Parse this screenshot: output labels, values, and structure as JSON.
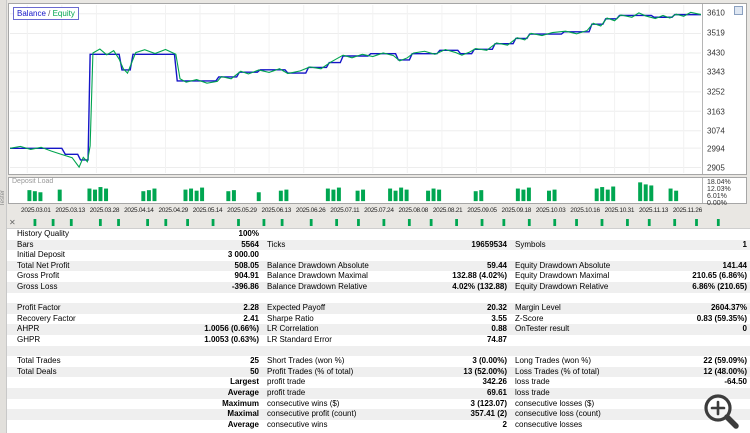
{
  "app": {
    "side_tab_label": "Tester"
  },
  "chart": {
    "legend": {
      "balance": "Balance",
      "separator": " / ",
      "equity": "Equity"
    },
    "y_axis_labels": [
      "3610",
      "3519",
      "3430",
      "3343",
      "3252",
      "3163",
      "3074",
      "2994",
      "2905"
    ],
    "colors": {
      "balance": "#1515c8",
      "equity": "#00a44e",
      "grid": "#ededed",
      "bar": "#00a651"
    }
  },
  "chart_data": [
    {
      "type": "line",
      "title": "Balance / Equity",
      "ylim": [
        2880,
        3650
      ],
      "y_ticks": [
        3610,
        3519,
        3430,
        3343,
        3252,
        3163,
        3074,
        2994,
        2905
      ],
      "legend_position": "top-left",
      "series": [
        {
          "name": "Balance",
          "color": "#1515c8",
          "points": [
            [
              0,
              2993
            ],
            [
              7.5,
              2993
            ],
            [
              8,
              2966
            ],
            [
              9.8,
              2966
            ],
            [
              10.2,
              2940
            ],
            [
              11.3,
              2940
            ],
            [
              11.6,
              3424
            ],
            [
              15.8,
              3424
            ],
            [
              16.2,
              3352
            ],
            [
              17.4,
              3352
            ],
            [
              17.8,
              3424
            ],
            [
              23.8,
              3424
            ],
            [
              24.2,
              3302
            ],
            [
              29.8,
              3302
            ],
            [
              30.2,
              3320
            ],
            [
              32.8,
              3320
            ],
            [
              33.2,
              3342
            ],
            [
              35.8,
              3342
            ],
            [
              36.2,
              3353
            ],
            [
              39.8,
              3353
            ],
            [
              40.2,
              3338
            ],
            [
              42.8,
              3338
            ],
            [
              43.2,
              3364
            ],
            [
              45.8,
              3364
            ],
            [
              46.2,
              3386
            ],
            [
              47.8,
              3386
            ],
            [
              48.2,
              3416
            ],
            [
              51.8,
              3416
            ],
            [
              52.2,
              3427
            ],
            [
              55.8,
              3427
            ],
            [
              56.2,
              3398
            ],
            [
              57.8,
              3398
            ],
            [
              58.2,
              3427
            ],
            [
              61.8,
              3427
            ],
            [
              62.2,
              3442
            ],
            [
              64.8,
              3442
            ],
            [
              65.2,
              3427
            ],
            [
              66.8,
              3427
            ],
            [
              67.2,
              3447
            ],
            [
              69.8,
              3447
            ],
            [
              70.2,
              3473
            ],
            [
              72.8,
              3473
            ],
            [
              73.2,
              3497
            ],
            [
              74.8,
              3497
            ],
            [
              75.2,
              3517
            ],
            [
              79.8,
              3517
            ],
            [
              80.2,
              3527
            ],
            [
              83.8,
              3527
            ],
            [
              84.2,
              3562
            ],
            [
              85.8,
              3562
            ],
            [
              86.2,
              3587
            ],
            [
              87.8,
              3587
            ],
            [
              88.2,
              3602
            ],
            [
              92.8,
              3602
            ],
            [
              93.2,
              3594
            ],
            [
              95.8,
              3594
            ],
            [
              96.2,
              3606
            ],
            [
              100,
              3606
            ]
          ]
        },
        {
          "name": "Equity",
          "color": "#00a44e",
          "points": [
            [
              0,
              2993
            ],
            [
              1.5,
              3002
            ],
            [
              3,
              2988
            ],
            [
              4.5,
              2998
            ],
            [
              6,
              2980
            ],
            [
              7.5,
              2965
            ],
            [
              9,
              2950
            ],
            [
              10,
              2907
            ],
            [
              10.6,
              2952
            ],
            [
              11.2,
              2932
            ],
            [
              11.6,
              3005
            ],
            [
              12,
              3430
            ],
            [
              13,
              3448
            ],
            [
              14,
              3422
            ],
            [
              15,
              3441
            ],
            [
              15.8,
              3402
            ],
            [
              16.4,
              3358
            ],
            [
              17,
              3338
            ],
            [
              17.6,
              3385
            ],
            [
              18.2,
              3432
            ],
            [
              19.5,
              3445
            ],
            [
              21,
              3428
            ],
            [
              22.5,
              3446
            ],
            [
              24,
              3424
            ],
            [
              24.6,
              3312
            ],
            [
              25.5,
              3296
            ],
            [
              27,
              3308
            ],
            [
              28.5,
              3292
            ],
            [
              30,
              3300
            ],
            [
              30.6,
              3322
            ],
            [
              32,
              3312
            ],
            [
              33.4,
              3346
            ],
            [
              34.5,
              3334
            ],
            [
              36,
              3352
            ],
            [
              37.5,
              3341
            ],
            [
              39,
              3358
            ],
            [
              40.2,
              3336
            ],
            [
              42,
              3348
            ],
            [
              43.4,
              3366
            ],
            [
              45,
              3358
            ],
            [
              46.4,
              3388
            ],
            [
              48.2,
              3420
            ],
            [
              49.5,
              3408
            ],
            [
              51,
              3424
            ],
            [
              52.5,
              3414
            ],
            [
              54,
              3430
            ],
            [
              55.5,
              3418
            ],
            [
              56.4,
              3394
            ],
            [
              57.5,
              3408
            ],
            [
              58.4,
              3430
            ],
            [
              60,
              3438
            ],
            [
              61.5,
              3424
            ],
            [
              63,
              3446
            ],
            [
              64.5,
              3432
            ],
            [
              65.4,
              3420
            ],
            [
              66.5,
              3434
            ],
            [
              67.4,
              3450
            ],
            [
              69,
              3442
            ],
            [
              70.4,
              3476
            ],
            [
              72,
              3466
            ],
            [
              73.4,
              3500
            ],
            [
              74.5,
              3490
            ],
            [
              75.4,
              3520
            ],
            [
              77,
              3510
            ],
            [
              78.5,
              3524
            ],
            [
              80.4,
              3530
            ],
            [
              82,
              3518
            ],
            [
              83.5,
              3532
            ],
            [
              84.4,
              3566
            ],
            [
              85.5,
              3554
            ],
            [
              86.4,
              3590
            ],
            [
              87.5,
              3578
            ],
            [
              88.4,
              3604
            ],
            [
              90,
              3594
            ],
            [
              91,
              3614
            ],
            [
              92,
              3600
            ],
            [
              93.4,
              3588
            ],
            [
              94.5,
              3602
            ],
            [
              95.5,
              3590
            ],
            [
              96.4,
              3608
            ],
            [
              97.5,
              3598
            ],
            [
              98.5,
              3616
            ],
            [
              100,
              3606
            ]
          ]
        }
      ]
    },
    {
      "type": "bar",
      "title": "Deposit Load",
      "ylim": [
        0,
        19.5
      ],
      "scale_labels": [
        "18.04%",
        "12.03%",
        "6.01%",
        "0.00%"
      ],
      "bars": [
        [
          2.8,
          10.5
        ],
        [
          3.6,
          9.5
        ],
        [
          4.4,
          8.5
        ],
        [
          7.2,
          11
        ],
        [
          11.5,
          12
        ],
        [
          12.3,
          11
        ],
        [
          13.1,
          13.5
        ],
        [
          13.9,
          12
        ],
        [
          19.3,
          9.5
        ],
        [
          20.1,
          10.5
        ],
        [
          20.9,
          12
        ],
        [
          25.4,
          11
        ],
        [
          26.2,
          12
        ],
        [
          27.0,
          10
        ],
        [
          27.8,
          13
        ],
        [
          31.6,
          9.5
        ],
        [
          32.4,
          10.5
        ],
        [
          36.0,
          8.5
        ],
        [
          39.2,
          10
        ],
        [
          40.0,
          11
        ],
        [
          46.0,
          12
        ],
        [
          46.8,
          11
        ],
        [
          47.6,
          13
        ],
        [
          50.3,
          10
        ],
        [
          51.1,
          11
        ],
        [
          55.0,
          12
        ],
        [
          55.8,
          10
        ],
        [
          56.6,
          13
        ],
        [
          57.4,
          11
        ],
        [
          60.5,
          10
        ],
        [
          61.3,
          12
        ],
        [
          62.1,
          11
        ],
        [
          67.4,
          9.5
        ],
        [
          68.2,
          10.5
        ],
        [
          73.5,
          12
        ],
        [
          74.3,
          11
        ],
        [
          75.1,
          13
        ],
        [
          78.0,
          10
        ],
        [
          78.8,
          11
        ],
        [
          84.9,
          12
        ],
        [
          85.7,
          13.5
        ],
        [
          86.5,
          11
        ],
        [
          87.3,
          14
        ],
        [
          91.2,
          18
        ],
        [
          92.0,
          16
        ],
        [
          92.8,
          15
        ],
        [
          95.6,
          12
        ],
        [
          96.4,
          10
        ]
      ]
    }
  ],
  "deposit": {
    "label": "Deposit Load"
  },
  "date_axis": {
    "labels": [
      "2025.03.01",
      "2025.03.13",
      "2025.03.28",
      "2025.04.14",
      "2025.04.29",
      "2025.05.14",
      "2025.05.29",
      "2025.06.13",
      "2025.06.26",
      "2025.07.11",
      "2025.07.24",
      "2025.08.08",
      "2025.08.21",
      "2025.09.05",
      "2025.09.18",
      "2025.10.03",
      "2025.10.16",
      "2025.10.31",
      "2025.11.13",
      "2025.11.26"
    ]
  },
  "tick_strip": {
    "close_label": "✕",
    "positions": [
      2,
      4.5,
      7,
      11,
      13.5,
      17.5,
      20,
      23,
      26.5,
      30,
      33.5,
      36,
      40,
      43.5,
      46.5,
      50,
      53.5,
      56.5,
      60,
      63.5,
      66.5,
      70,
      73.5,
      76.5,
      80,
      83.5,
      86.5,
      90,
      93,
      96
    ]
  },
  "table": {
    "rows": [
      {
        "cells": [
          "History Quality",
          "100%",
          "",
          "",
          "",
          ""
        ]
      },
      {
        "cells": [
          "Bars",
          "5564",
          "Ticks",
          "19659534",
          "Symbols",
          "1"
        ]
      },
      {
        "cells": [
          "Initial Deposit",
          "3 000.00",
          "",
          "",
          "",
          ""
        ]
      },
      {
        "cells": [
          "Total Net Profit",
          "508.05",
          "Balance Drawdown Absolute",
          "59.44",
          "Equity Drawdown Absolute",
          "141.44"
        ]
      },
      {
        "cells": [
          "Gross Profit",
          "904.91",
          "Balance Drawdown Maximal",
          "132.88 (4.02%)",
          "Equity Drawdown Maximal",
          "210.65 (6.86%)"
        ]
      },
      {
        "cells": [
          "Gross Loss",
          "-396.86",
          "Balance Drawdown Relative",
          "4.02% (132.88)",
          "Equity Drawdown Relative",
          "6.86% (210.65)"
        ]
      },
      {
        "cells": [
          "",
          "",
          "",
          "",
          "",
          ""
        ]
      },
      {
        "cells": [
          "Profit Factor",
          "2.28",
          "Expected Payoff",
          "20.32",
          "Margin Level",
          "2604.37%"
        ]
      },
      {
        "cells": [
          "Recovery Factor",
          "2.41",
          "Sharpe Ratio",
          "3.55",
          "Z-Score",
          "0.83 (59.35%)"
        ]
      },
      {
        "cells": [
          "AHPR",
          "1.0056 (0.66%)",
          "LR Correlation",
          "0.88",
          "OnTester result",
          "0"
        ]
      },
      {
        "cells": [
          "GHPR",
          "1.0053 (0.63%)",
          "LR Standard Error",
          "74.87",
          "",
          ""
        ]
      },
      {
        "cells": [
          "",
          "",
          "",
          "",
          "",
          ""
        ]
      },
      {
        "cells": [
          "Total Trades",
          "25",
          "Short Trades (won %)",
          "3 (0.00%)",
          "Long Trades (won %)",
          "22 (59.09%)"
        ]
      },
      {
        "cells": [
          "Total Deals",
          "50",
          "Profit Trades (% of total)",
          "13 (52.00%)",
          "Loss Trades (% of total)",
          "12 (48.00%)"
        ]
      },
      {
        "cells": [
          "",
          "Largest",
          "profit trade",
          "342.26",
          "loss trade",
          "-64.50"
        ]
      },
      {
        "cells": [
          "",
          "Average",
          "profit trade",
          "69.61",
          "loss trade",
          ""
        ]
      },
      {
        "cells": [
          "",
          "Maximum",
          "consecutive wins ($)",
          "3 (123.07)",
          "consecutive losses ($)",
          ""
        ]
      },
      {
        "cells": [
          "",
          "Maximal",
          "consecutive profit (count)",
          "357.41 (2)",
          "consecutive loss (count)",
          ""
        ]
      },
      {
        "cells": [
          "",
          "Average",
          "consecutive wins",
          "2",
          "consecutive losses",
          ""
        ]
      }
    ]
  }
}
